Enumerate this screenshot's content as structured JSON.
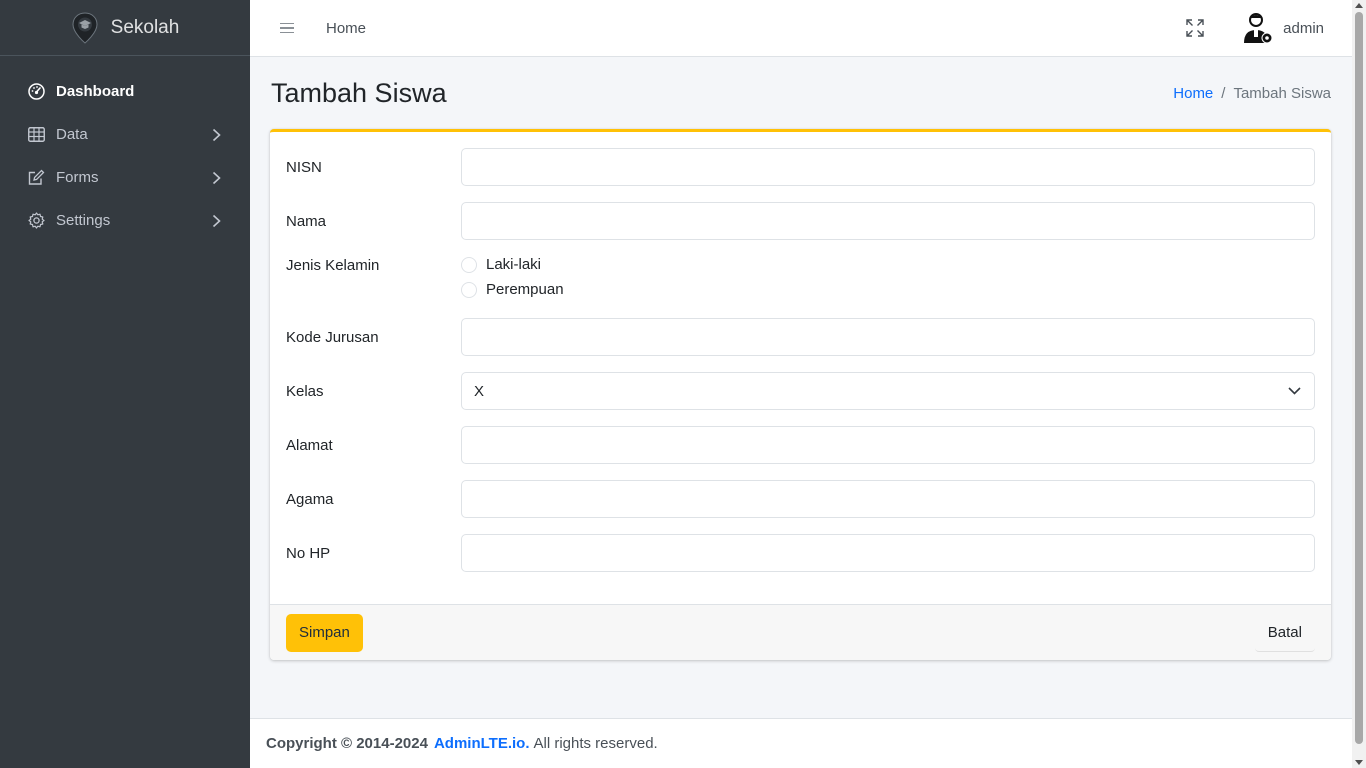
{
  "brand": {
    "name": "Sekolah",
    "logo_icon": "school-pin-icon"
  },
  "sidebar": {
    "items": [
      {
        "label": "Dashboard",
        "icon": "speedometer-icon",
        "active": true
      },
      {
        "label": "Data",
        "icon": "table-icon",
        "has_children": true
      },
      {
        "label": "Forms",
        "icon": "pencil-square-icon",
        "has_children": true
      },
      {
        "label": "Settings",
        "icon": "gear-icon",
        "has_children": true
      }
    ]
  },
  "topbar": {
    "home_link": "Home",
    "user_name": "admin"
  },
  "page": {
    "title": "Tambah Siswa",
    "breadcrumb": {
      "home": "Home",
      "separator": "/",
      "current": "Tambah Siswa"
    }
  },
  "form": {
    "nisn": {
      "label": "NISN",
      "value": ""
    },
    "nama": {
      "label": "Nama",
      "value": ""
    },
    "jenis_kelamin": {
      "label": "Jenis Kelamin",
      "options": [
        "Laki-laki",
        "Perempuan"
      ]
    },
    "kode_jurusan": {
      "label": "Kode Jurusan",
      "value": ""
    },
    "kelas": {
      "label": "Kelas",
      "selected": "X"
    },
    "alamat": {
      "label": "Alamat",
      "value": ""
    },
    "agama": {
      "label": "Agama",
      "value": ""
    },
    "no_hp": {
      "label": "No HP",
      "value": ""
    },
    "submit_label": "Simpan",
    "cancel_label": "Batal"
  },
  "footer": {
    "copyright": "Copyright © 2014-2024",
    "link": "AdminLTE.io.",
    "rest": "All rights reserved."
  },
  "colors": {
    "accent": "#ffc107",
    "link": "#0d6efd",
    "sidebar": "#343a40"
  }
}
